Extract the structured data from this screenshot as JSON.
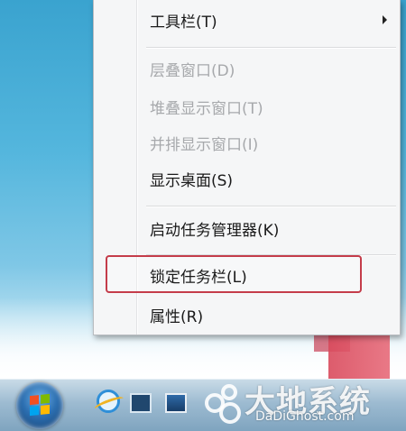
{
  "menu": {
    "items": [
      {
        "label": "工具栏(T)",
        "enabled": true,
        "submenu": true
      },
      {
        "label": "层叠窗口(D)",
        "enabled": false
      },
      {
        "label": "堆叠显示窗口(T)",
        "enabled": false
      },
      {
        "label": "并排显示窗口(I)",
        "enabled": false
      },
      {
        "label": "显示桌面(S)",
        "enabled": true
      },
      {
        "label": "启动任务管理器(K)",
        "enabled": true
      },
      {
        "label": "锁定任务栏(L)",
        "enabled": true,
        "highlighted": true
      },
      {
        "label": "属性(R)",
        "enabled": true
      }
    ]
  },
  "taskbar": {
    "icons": [
      "windows-start-orb",
      "internet-explorer-icon",
      "window-switch-icon",
      "show-desktop-icon"
    ]
  },
  "watermark": {
    "text": "大地系统",
    "url_text": "DaDiGhost.com"
  },
  "colors": {
    "highlight_border": "#c43c4a",
    "menu_bg": "#f5f6f7",
    "desktop": "#54b6dd"
  }
}
